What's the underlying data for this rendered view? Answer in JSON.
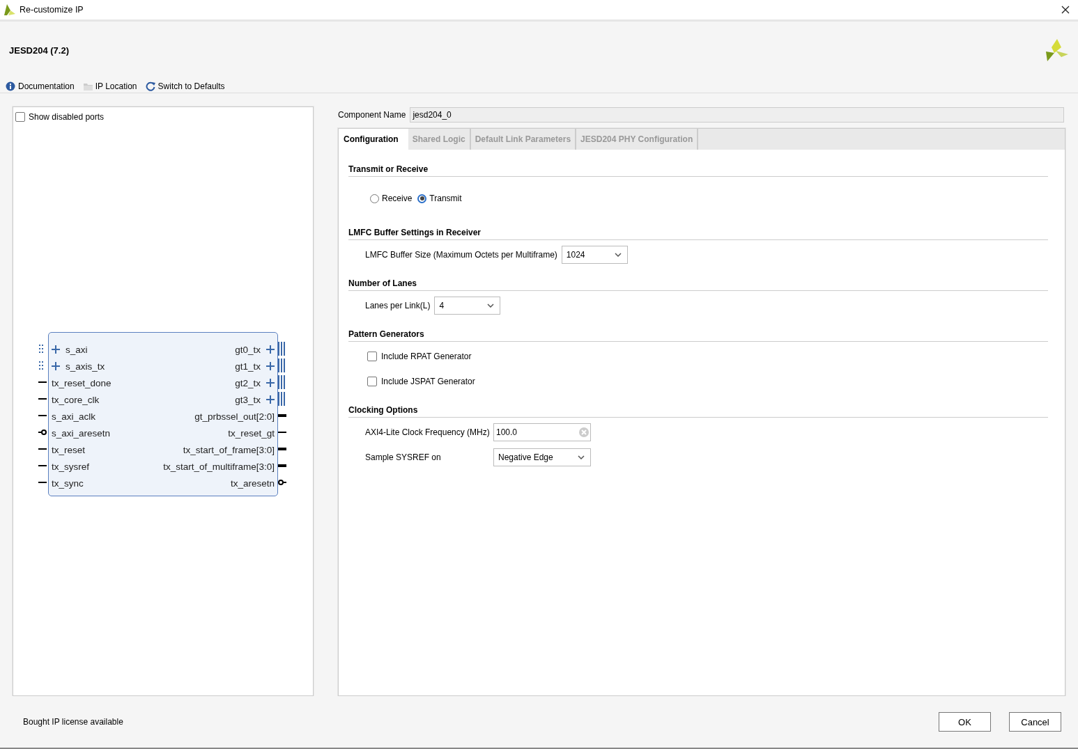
{
  "window": {
    "title": "Re-customize IP"
  },
  "header": {
    "title": "JESD204 (7.2)",
    "toolbar": [
      {
        "label": "Documentation",
        "kind": "info"
      },
      {
        "label": "IP Location",
        "kind": "folder"
      },
      {
        "label": "Switch to Defaults",
        "kind": "refresh"
      }
    ]
  },
  "left_panel": {
    "show_disabled_ports": {
      "label": "Show disabled ports",
      "checked": false
    },
    "block": {
      "left_ports": [
        {
          "name": "s_axi",
          "kind": "interface"
        },
        {
          "name": "s_axis_tx",
          "kind": "interface"
        },
        {
          "name": "tx_reset_done",
          "kind": "signal"
        },
        {
          "name": "tx_core_clk",
          "kind": "signal"
        },
        {
          "name": "s_axi_aclk",
          "kind": "signal"
        },
        {
          "name": "s_axi_aresetn",
          "kind": "active_low"
        },
        {
          "name": "tx_reset",
          "kind": "signal"
        },
        {
          "name": "tx_sysref",
          "kind": "signal"
        },
        {
          "name": "tx_sync",
          "kind": "signal"
        }
      ],
      "right_ports": [
        {
          "name": "gt0_tx",
          "kind": "interface"
        },
        {
          "name": "gt1_tx",
          "kind": "interface"
        },
        {
          "name": "gt2_tx",
          "kind": "interface"
        },
        {
          "name": "gt3_tx",
          "kind": "interface"
        },
        {
          "name": "gt_prbssel_out[2:0]",
          "kind": "bus"
        },
        {
          "name": "tx_reset_gt",
          "kind": "signal"
        },
        {
          "name": "tx_start_of_frame[3:0]",
          "kind": "bus"
        },
        {
          "name": "tx_start_of_multiframe[3:0]",
          "kind": "bus"
        },
        {
          "name": "tx_aresetn",
          "kind": "active_low"
        }
      ]
    }
  },
  "component_name": {
    "label": "Component Name",
    "value": "jesd204_0"
  },
  "tabs": [
    {
      "label": "Configuration",
      "selected": true
    },
    {
      "label": "Shared Logic",
      "selected": false
    },
    {
      "label": "Default Link Parameters",
      "selected": false
    },
    {
      "label": "JESD204 PHY Configuration",
      "selected": false
    }
  ],
  "sections": [
    {
      "title": "Transmit or Receive",
      "fields": [
        {
          "kind": "radio",
          "options": [
            {
              "label": "Receive",
              "selected": false
            },
            {
              "label": "Transmit",
              "selected": true
            }
          ]
        }
      ]
    },
    {
      "title": "LMFC Buffer Settings in Receiver",
      "fields": [
        {
          "kind": "dropdown",
          "label": "LMFC Buffer Size (Maximum Octets per Multiframe)",
          "value": "1024"
        }
      ]
    },
    {
      "title": "Number of Lanes",
      "fields": [
        {
          "kind": "dropdown",
          "label": "Lanes per Link(L)",
          "value": "4"
        }
      ]
    },
    {
      "title": "Pattern Generators",
      "fields": [
        {
          "kind": "checkbox",
          "label": "Include RPAT Generator",
          "checked": false
        },
        {
          "kind": "checkbox",
          "label": "Include JSPAT Generator",
          "checked": false
        }
      ]
    },
    {
      "title": "Clocking Options",
      "fields": [
        {
          "kind": "text",
          "label": "AXI4-Lite Clock Frequency (MHz)",
          "value": "100.0"
        },
        {
          "kind": "dropdown",
          "label": "Sample SYSREF on",
          "value": "Negative Edge"
        }
      ]
    }
  ],
  "footer": {
    "status": "Bought IP license available",
    "buttons": [
      "OK",
      "Cancel"
    ]
  }
}
